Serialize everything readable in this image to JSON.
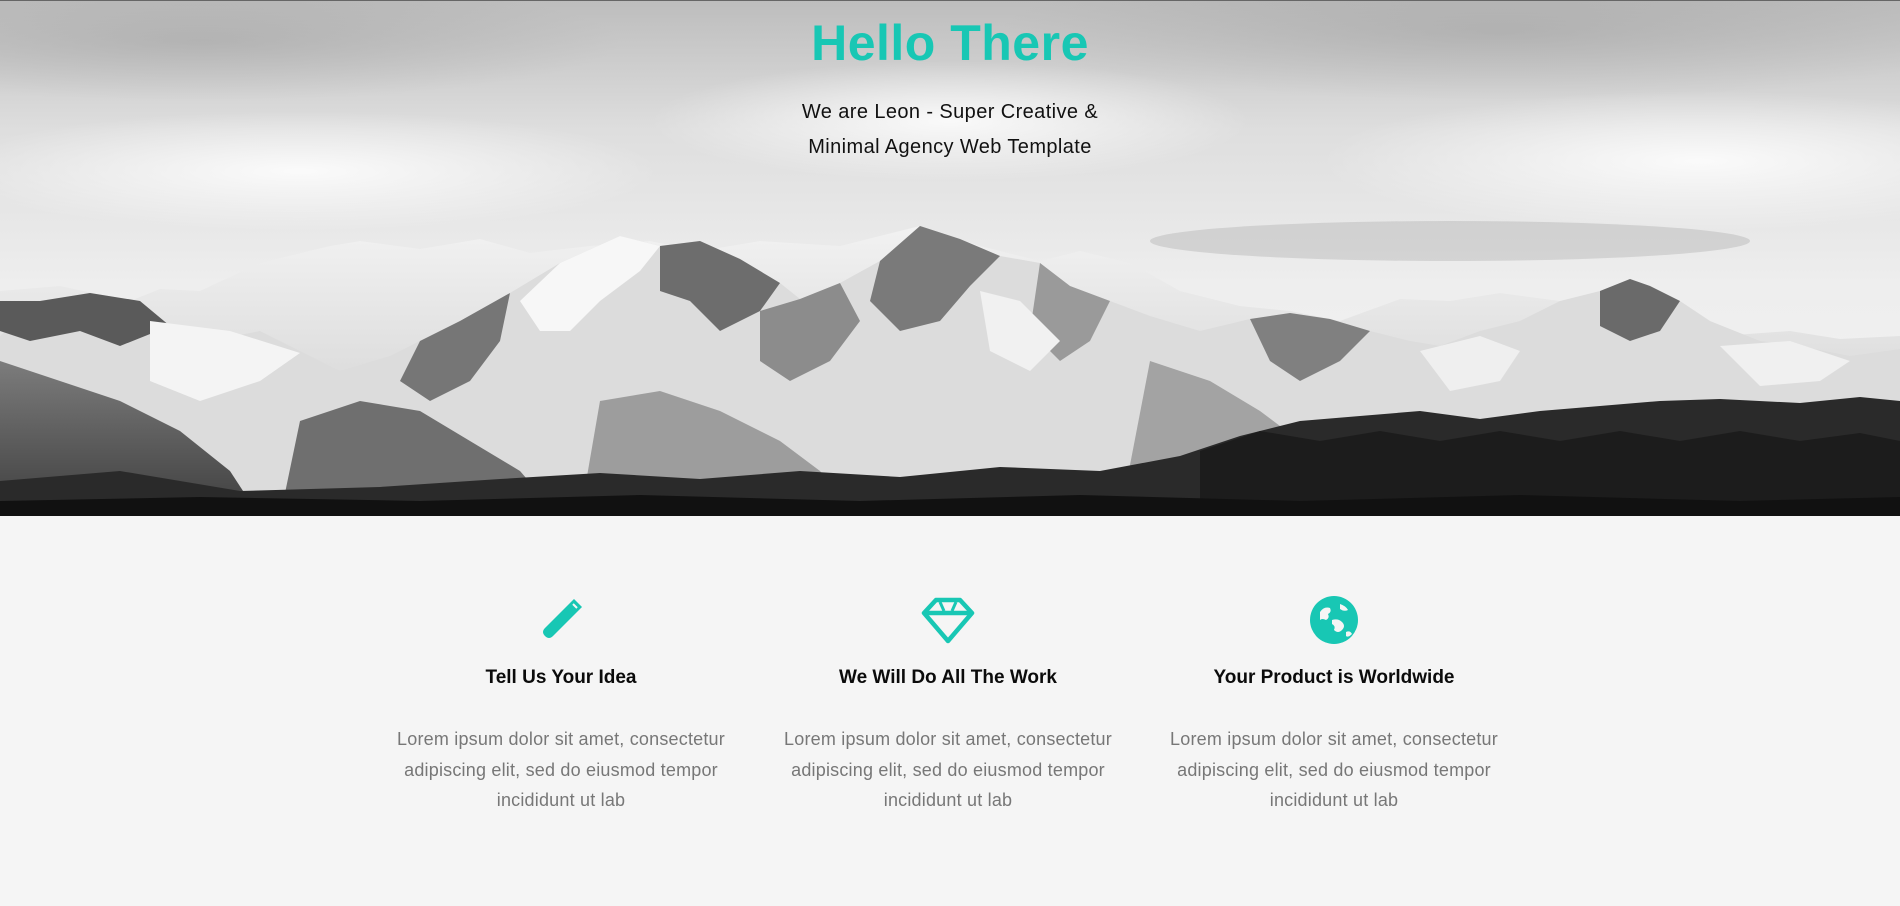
{
  "colors": {
    "accent": "#18c7b4",
    "heading": "#0b0b0b",
    "body_text": "#777777",
    "background": "#f5f5f5"
  },
  "hero": {
    "title": "Hello There",
    "subtitle": "We are Leon - Super Creative & Minimal Agency Web Template",
    "background_image": "snowy-mountain-range-grayscale"
  },
  "features": [
    {
      "icon": "pencil-icon",
      "title": "Tell Us Your Idea",
      "text": "Lorem ipsum dolor sit amet, consectetur adipiscing elit, sed do eiusmod tempor incididunt ut lab"
    },
    {
      "icon": "diamond-icon",
      "title": "We Will Do All The Work",
      "text": "Lorem ipsum dolor sit amet, consectetur adipiscing elit, sed do eiusmod tempor incididunt ut lab"
    },
    {
      "icon": "globe-icon",
      "title": "Your Product is Worldwide",
      "text": "Lorem ipsum dolor sit amet, consectetur adipiscing elit, sed do eiusmod tempor incididunt ut lab"
    }
  ]
}
